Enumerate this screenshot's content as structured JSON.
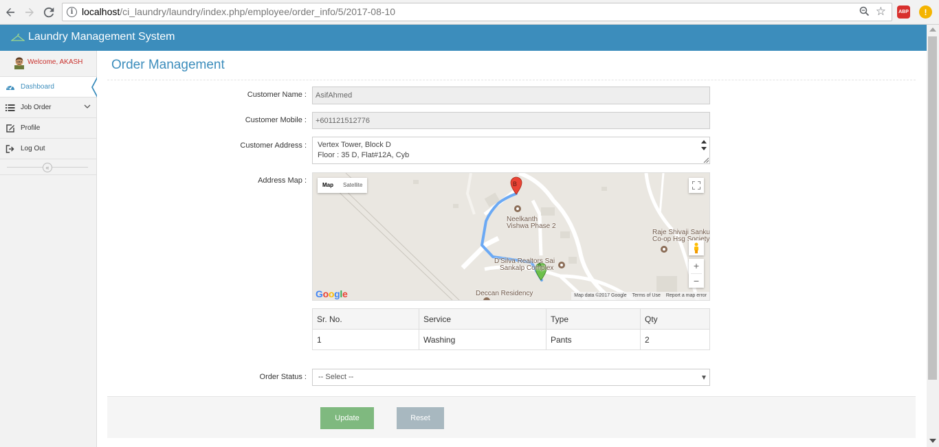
{
  "browser": {
    "url_host": "localhost",
    "url_path": "/ci_laundry/laundry/index.php/employee/order_info/5/2017-08-10",
    "ext_abp": "ABP",
    "ext_alert": "!"
  },
  "app": {
    "title": "Laundry Management System",
    "brand_color": "#3c8dbc"
  },
  "sidebar": {
    "welcome": "Welcome, AKASH",
    "items": [
      {
        "label": "Dashboard",
        "icon": "dashboard-icon",
        "active": true
      },
      {
        "label": "Job Order",
        "icon": "list-icon",
        "expandable": true
      },
      {
        "label": "Profile",
        "icon": "edit-icon"
      },
      {
        "label": "Log Out",
        "icon": "logout-icon"
      }
    ],
    "collapse_glyph": "«"
  },
  "main": {
    "title": "Order Management",
    "form": {
      "customer_name_label": "Customer Name :",
      "customer_name_value": "AsifAhmed",
      "customer_mobile_label": "Customer Mobile :",
      "customer_mobile_value": "+601121512776",
      "customer_address_label": "Customer Address :",
      "customer_address_line1": "Vertex Tower, Block D",
      "customer_address_line2": "Floor : 35 D, Flat#12A, Cyb",
      "address_map_label": "Address Map :",
      "order_status_label": "Order Status :",
      "order_status_selected": "-- Select --"
    },
    "map": {
      "type_map": "Map",
      "type_satellite": "Satellite",
      "zoom_in": "+",
      "zoom_out": "−",
      "google": "Google",
      "footer": {
        "data": "Map data ©2017 Google",
        "terms": "Terms of Use",
        "report": "Report a map error"
      },
      "labels": {
        "neelkanth_1": "Neelkanth",
        "neelkanth_2": "Vishwa Phase 2",
        "raje_1": "Raje Shivaji Sanku",
        "raje_2": "Co-op Hsg Society",
        "dsilva_1": "D'Silva Realtors Sai",
        "dsilva_2": "Sankalp Complex",
        "deccan": "Deccan Residency"
      },
      "marker_a": "A",
      "marker_b": "B"
    },
    "table": {
      "headers": [
        "Sr. No.",
        "Service",
        "Type",
        "Qty"
      ],
      "rows": [
        [
          "1",
          "Washing",
          "Pants",
          "2"
        ]
      ]
    },
    "buttons": {
      "update": "Update",
      "reset": "Reset"
    }
  }
}
